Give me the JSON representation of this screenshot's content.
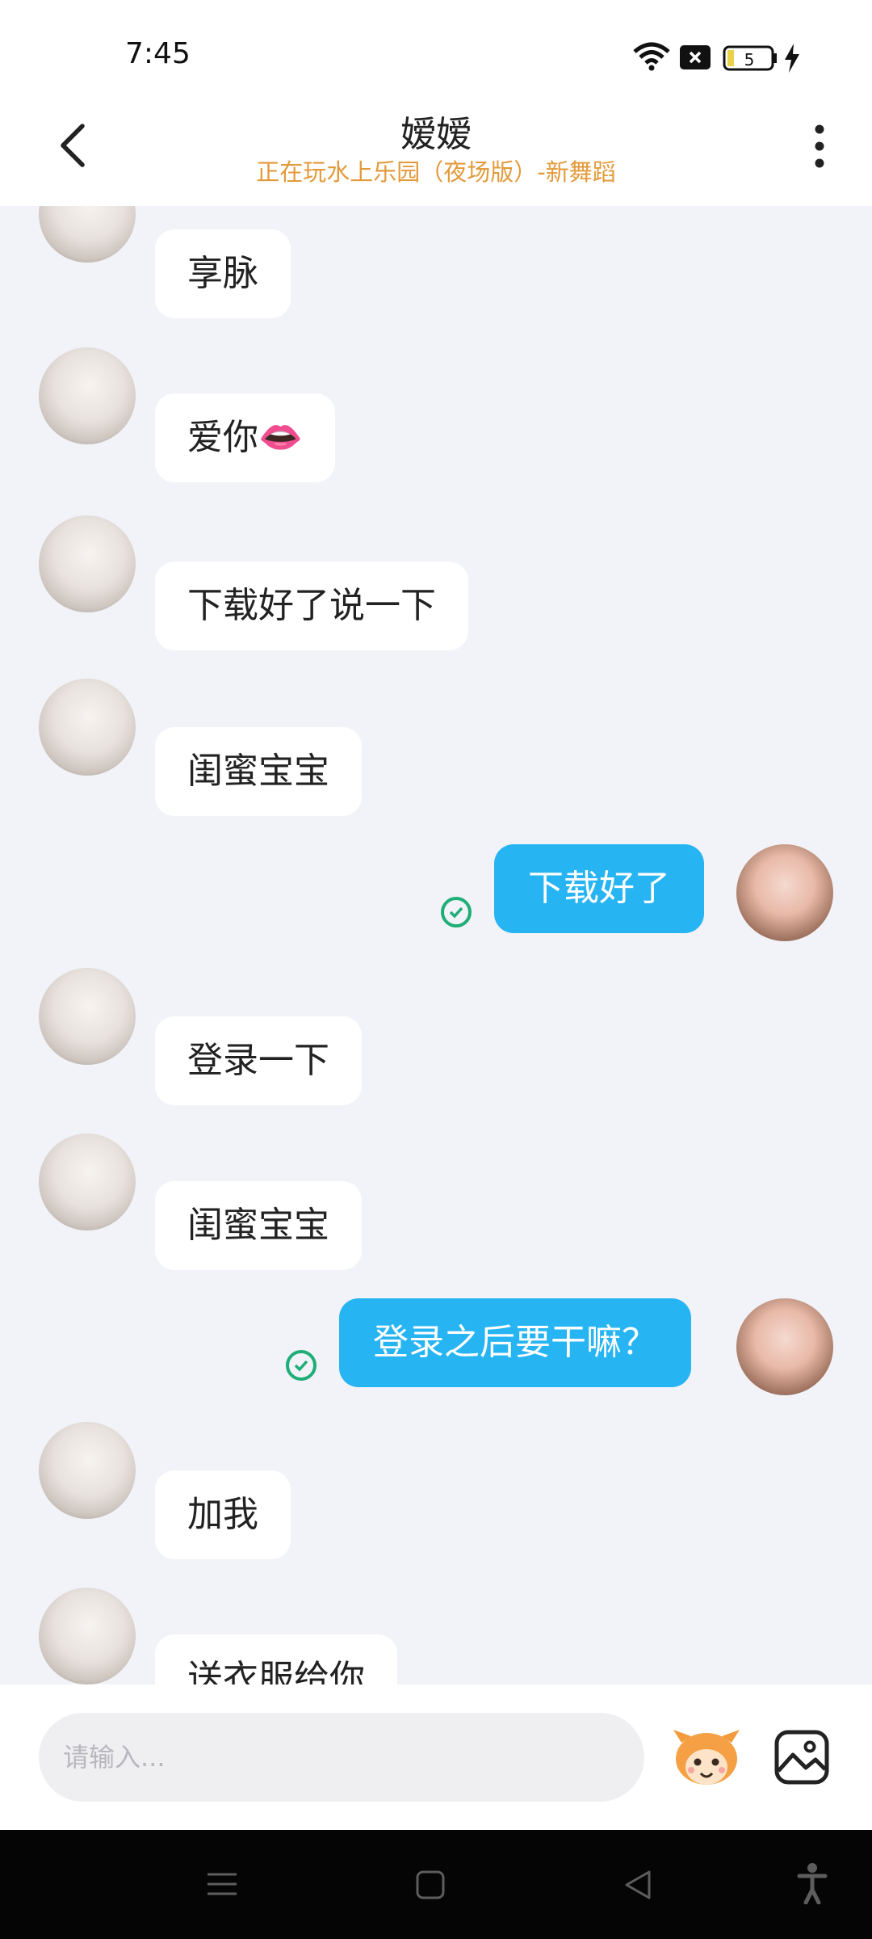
{
  "status_bar": {
    "time": "7:45",
    "battery_level": "5"
  },
  "header": {
    "title": "嫒嫒",
    "subtitle": "正在玩水上乐园（夜场版）-新舞蹈"
  },
  "messages": [
    {
      "side": "left",
      "text": "享脉"
    },
    {
      "side": "left",
      "text": "爱你👄"
    },
    {
      "side": "left",
      "text": "下载好了说一下"
    },
    {
      "side": "left",
      "text": "闺蜜宝宝"
    },
    {
      "side": "right",
      "text": "下载好了"
    },
    {
      "side": "left",
      "text": "登录一下"
    },
    {
      "side": "left",
      "text": "闺蜜宝宝"
    },
    {
      "side": "right",
      "text": "登录之后要干嘛？"
    },
    {
      "side": "left",
      "text": "加我"
    },
    {
      "side": "left",
      "text": "送衣服给你"
    }
  ],
  "input": {
    "placeholder": "请输入..."
  },
  "colors": {
    "accent": "#27b4f2",
    "subtitle": "#e39a3b",
    "read_check": "#1fae76"
  }
}
